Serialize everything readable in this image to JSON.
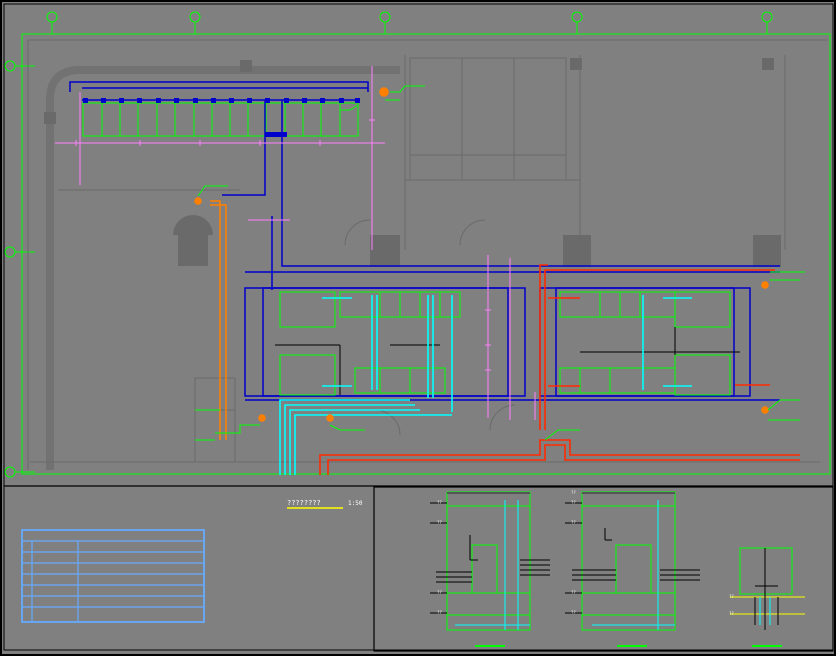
{
  "plan": {
    "title": "????????",
    "scale": "1:50"
  },
  "colors": {
    "background": "#808080",
    "frame": "#000000",
    "grid_green": "#00ff00",
    "duct_blue": "#0000cc",
    "dim_magenta": "#ff80ff",
    "pipe_cyan": "#00ffff",
    "pipe_red": "#ff2a00",
    "pipe_orange": "#ff8000",
    "wall_grey": "#6e6e6e",
    "title_table": "#66aaff",
    "scale_underline": "#ffff00"
  },
  "sections": {
    "label_text": "??",
    "count": 3
  }
}
